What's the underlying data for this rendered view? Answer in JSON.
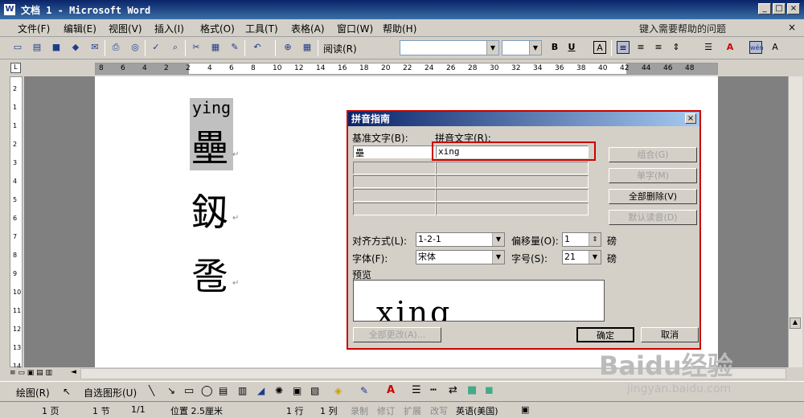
{
  "window": {
    "title": "文档 1 - Microsoft Word",
    "icon": "W"
  },
  "menu": [
    "文件(F)",
    "编辑(E)",
    "视图(V)",
    "插入(I)",
    "格式(O)",
    "工具(T)",
    "表格(A)",
    "窗口(W)",
    "帮助(H)"
  ],
  "help_box": "键入需要帮助的问题",
  "toolbar": {
    "read_label": "阅读(R)"
  },
  "hruler_labels": [
    "8",
    "6",
    "4",
    "2",
    "2",
    "4",
    "6",
    "8",
    "10",
    "12",
    "14",
    "16",
    "18",
    "20",
    "22",
    "24",
    "26",
    "28",
    "30",
    "32",
    "34",
    "36",
    "38",
    "40",
    "42",
    "44",
    "46",
    "48"
  ],
  "vruler_labels": [
    "2",
    "1",
    "1",
    "2",
    "3",
    "4",
    "5",
    "6",
    "7",
    "8",
    "9",
    "10",
    "11",
    "12",
    "13",
    "14"
  ],
  "document": {
    "ruby_text": "ying",
    "ruby_base": "壘",
    "char2": "釼",
    "char3": "卺"
  },
  "dialog": {
    "title": "拼音指南",
    "base_text_label": "基准文字(B):",
    "ruby_text_label": "拼音文字(R):",
    "base_value": "壘",
    "ruby_value": "xing",
    "buttons": {
      "group": "组合(G)",
      "single": "单字(M)",
      "clear_all": "全部删除(V)",
      "default": "默认读音(D)",
      "apply_all": "全部更改(A)...",
      "ok": "确定",
      "cancel": "取消"
    },
    "align_label": "对齐方式(L):",
    "align_value": "1-2-1",
    "offset_label": "偏移量(O):",
    "offset_value": "1",
    "offset_unit": "磅",
    "font_label": "字体(F):",
    "font_value": "宋体",
    "size_label": "字号(S):",
    "size_value": "21",
    "size_unit": "磅",
    "preview_label": "预览",
    "preview_text": "xing"
  },
  "drawbar": {
    "draw": "绘图(R)",
    "autoshapes": "自选图形(U)"
  },
  "status": {
    "page": "1 页",
    "section": "1 节",
    "pages": "1/1",
    "position": "位置 2.5厘米",
    "line": "1 行",
    "col": "1 列",
    "rec": "录制",
    "trk": "修订",
    "ext": "扩展",
    "ovr": "改写",
    "lang": "英语(美国)"
  },
  "watermark": {
    "brand": "Baidu经验",
    "url": "jingyan.baidu.com"
  }
}
